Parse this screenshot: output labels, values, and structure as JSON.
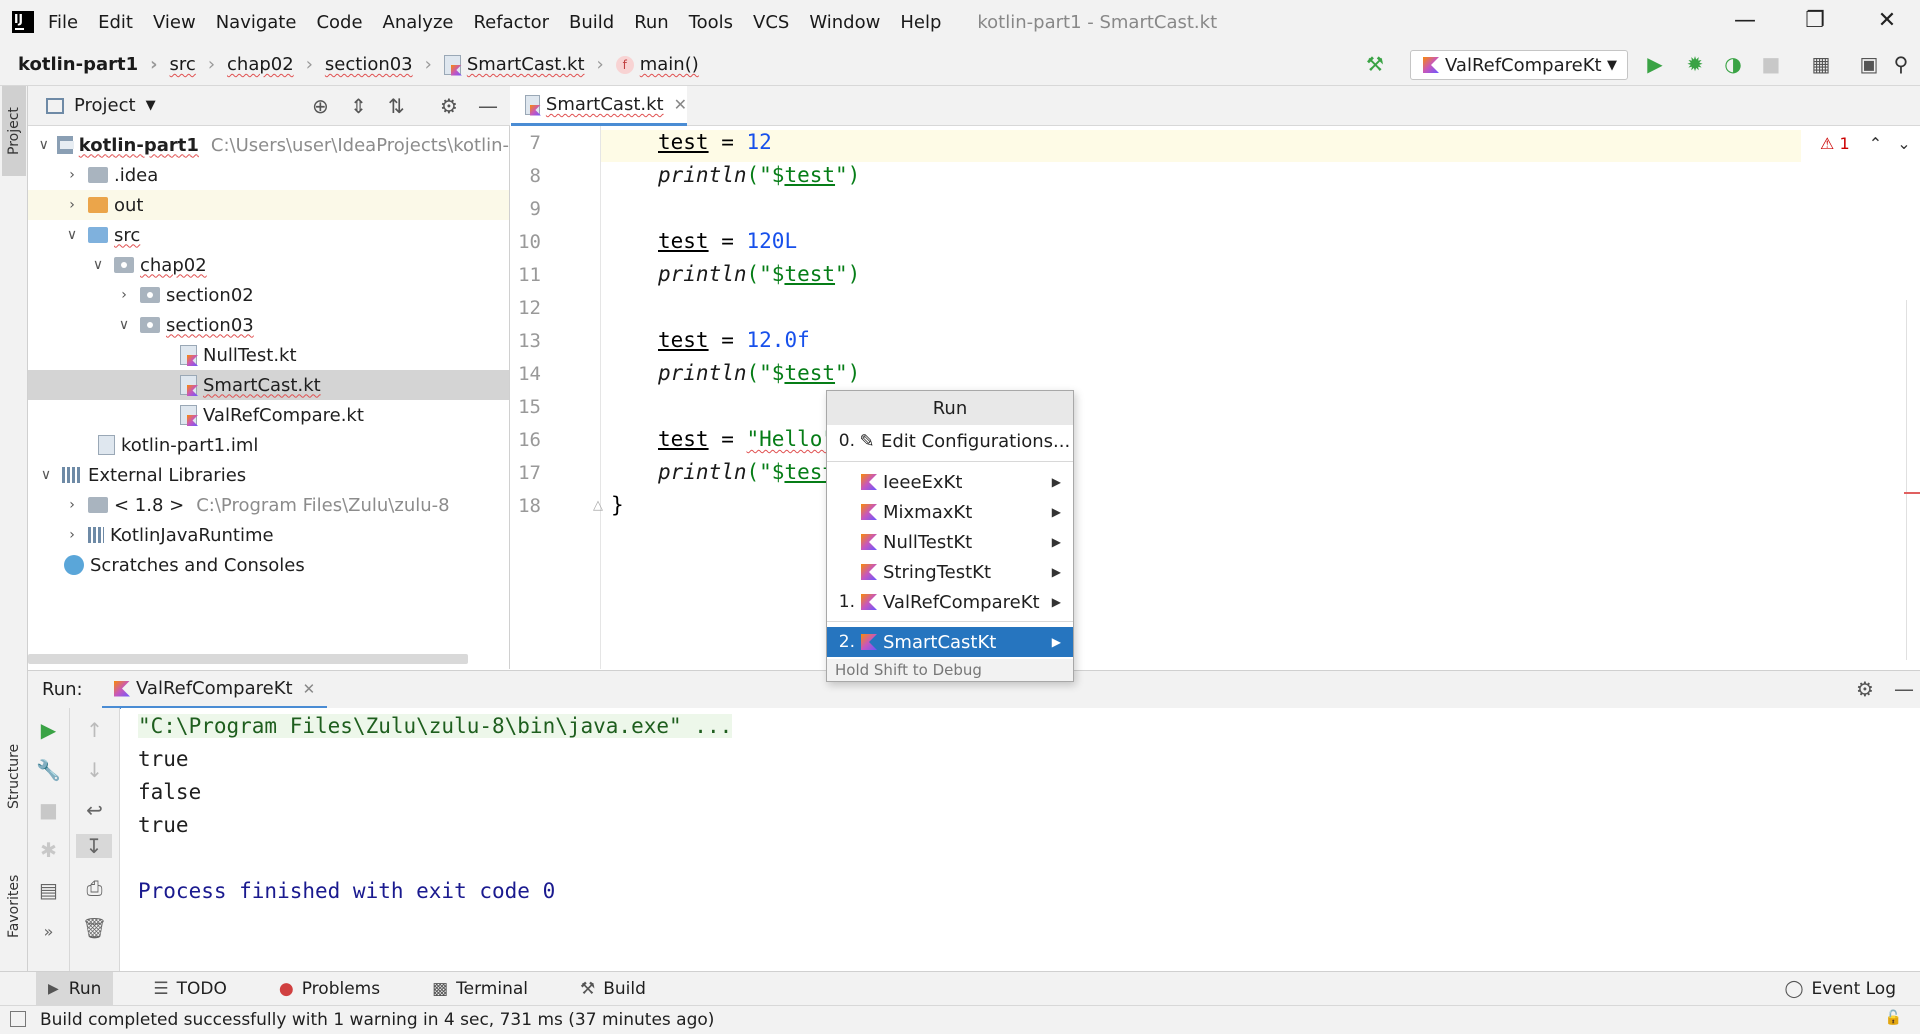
{
  "menubar": {
    "items": [
      "File",
      "Edit",
      "View",
      "Navigate",
      "Code",
      "Analyze",
      "Refactor",
      "Build",
      "Run",
      "Tools",
      "VCS",
      "Window",
      "Help"
    ],
    "window_title": "kotlin-part1 - SmartCast.kt"
  },
  "breadcrumb": {
    "project": "kotlin-part1",
    "src": "src",
    "chap": "chap02",
    "section": "section03",
    "file": "SmartCast.kt",
    "function": "main()"
  },
  "run_config": {
    "selected": "ValRefCompareKt"
  },
  "project_panel": {
    "title": "Project",
    "tree": {
      "root": {
        "label": "kotlin-part1",
        "path": "C:\\Users\\user\\IdeaProjects\\kotlin-"
      },
      "idea": ".idea",
      "out": "out",
      "src": "src",
      "chap02": "chap02",
      "section02": "section02",
      "section03": "section03",
      "file1": "NullTest.kt",
      "file2": "SmartCast.kt",
      "file3": "ValRefCompare.kt",
      "iml": "kotlin-part1.iml",
      "ext_libs": "External Libraries",
      "jdk": {
        "label": "< 1.8 >",
        "path": "C:\\Program Files\\Zulu\\zulu-8"
      },
      "kjr": "KotlinJavaRuntime",
      "scratches": "Scratches and Consoles"
    }
  },
  "side_tabs": {
    "project": "Project",
    "structure": "Structure",
    "favorites": "Favorites"
  },
  "editor": {
    "tab_label": "SmartCast.kt",
    "error_count": "1",
    "line_numbers": [
      "7",
      "8",
      "9",
      "10",
      "11",
      "12",
      "13",
      "14",
      "15",
      "16",
      "17",
      "18"
    ],
    "code": {
      "l7_var": "test",
      "l7_op": " = ",
      "l7_val": "12",
      "l8_fn": "println",
      "l8_open": "(\"$",
      "l8_var": "test",
      "l8_close": "\")",
      "l10_var": "test",
      "l10_op": " = ",
      "l10_val": "120L",
      "l11_fn": "println",
      "l11_open": "(\"$",
      "l11_var": "test",
      "l11_close": "\")",
      "l13_var": "test",
      "l13_op": " = ",
      "l13_val": "12.0f",
      "l14_fn": "println",
      "l14_open": "(\"$",
      "l14_var": "test",
      "l14_close": "\")",
      "l16_var": "test",
      "l16_op": " = ",
      "l16_val": "\"Hello\"",
      "l17_fn": "println",
      "l17_open": "(\"$",
      "l17_var": "test",
      "l18": "}"
    }
  },
  "run_popup": {
    "title": "Run",
    "edit_num": "0.",
    "edit_label": "Edit Configurations...",
    "items": [
      {
        "num": "",
        "label": "IeeeExKt"
      },
      {
        "num": "",
        "label": "MixmaxKt"
      },
      {
        "num": "",
        "label": "NullTestKt"
      },
      {
        "num": "",
        "label": "StringTestKt"
      },
      {
        "num": "1.",
        "label": "ValRefCompareKt"
      },
      {
        "num": "2.",
        "label": "SmartCastKt"
      }
    ],
    "footer": "Hold Shift to Debug"
  },
  "run_panel": {
    "label": "Run:",
    "tab": "ValRefCompareKt",
    "console": [
      "\"C:\\Program Files\\Zulu\\zulu-8\\bin\\java.exe\" ...",
      "true",
      "false",
      "true",
      "Process finished with exit code 0"
    ]
  },
  "bottom_tabs": {
    "run": "Run",
    "todo": "TODO",
    "problems": "Problems",
    "terminal": "Terminal",
    "build": "Build",
    "event_log": "Event Log"
  },
  "status": "Build completed successfully with 1 warning in 4 sec, 731 ms (37 minutes ago)",
  "colors": {
    "selection": "#2675bf",
    "tab_underline": "#4a8cd4",
    "run_green": "#3aa345",
    "string": "#067d17",
    "number": "#1750eb"
  }
}
